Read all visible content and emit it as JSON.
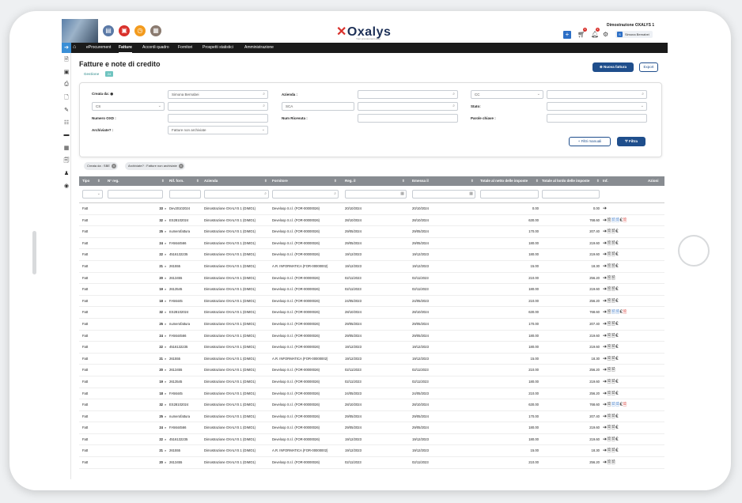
{
  "header": {
    "logo": "Oxalys",
    "logo_tagline": "Your procurement easy",
    "org_name": "Dimostrazione OXALYS 1",
    "user_initial": "S",
    "user_name": "Simona Bernabei",
    "cart_badge": "3",
    "bell_badge": "2",
    "icons": [
      "catalog-icon",
      "requests-icon",
      "timer-icon",
      "document-icon",
      "plus-icon",
      "cart-icon",
      "bell-icon",
      "settings-icon"
    ]
  },
  "nav": {
    "items": [
      "eProcurement",
      "Fatture",
      "Accordi quadro",
      "Fornitori",
      "Prospetti statistici",
      "Amministrazione"
    ],
    "active": "Fatture"
  },
  "page": {
    "title": "Fatture e note di credito",
    "subtitle": "Gestione",
    "subtitle_badge": "24",
    "new_button": "Nuova fattura",
    "export_button": "Export"
  },
  "filters": {
    "created_by_label": "Creata da:",
    "created_by_value": "Simona Bernabei",
    "cs_value": "CS",
    "azienda_label": "Azienda :",
    "sca_value": "SCA",
    "cc_value": "CC",
    "stato_label": "Stato:",
    "numero_oxd_label": "Numero OXD :",
    "num_ricevuta_label": "Num Ricevuta :",
    "parole_chiave_label": "Parole chiave :",
    "archiviate_label": "Archiviate? :",
    "archiviate_value": "Fatture non archiviate",
    "manual_filters_button": "Filtri manuali",
    "filter_button": "Filtra"
  },
  "chips": [
    "Creata da : SBE",
    "Archiviate? : Fatture non archiviate"
  ],
  "table": {
    "columns": [
      "Tipo",
      "N° reg.",
      "Rif. forn.",
      "Azienda",
      "Fornitore",
      "Reg. il",
      "Emessa il",
      "Totale al netto delle imposte",
      "Totale al lordo delle imposte",
      "Inf.",
      "Azioni"
    ],
    "rows": [
      {
        "tipo": "Fatt",
        "nreg": "33",
        "rif": "Dev20102024",
        "azienda": "Dimostrazione OXALYS 1 (DIMO1)",
        "fornitore": "Develoop S.r.l. (FOR-00000026)",
        "reg": "20/10/2024",
        "emessa": "20/10/2024",
        "netto": "0.00",
        "lordo": "0.00",
        "acts": "➔"
      },
      {
        "tipo": "Fatt",
        "nreg": "32",
        "rif": "ES28102024",
        "azienda": "Dimostrazione OXALYS 1 (DIMO1)",
        "fornitore": "Develoop S.r.l. (FOR-00000026)",
        "reg": "28/10/2024",
        "emessa": "28/10/2024",
        "netto": "630.00",
        "lordo": "768.60",
        "acts": "full"
      },
      {
        "tipo": "Fatt",
        "nreg": "25",
        "rif": "numerofattura",
        "azienda": "Dimostrazione OXALYS 1 (DIMO1)",
        "fornitore": "Develoop S.r.l. (FOR-00000026)",
        "reg": "29/05/2024",
        "emessa": "29/05/2024",
        "netto": "170.00",
        "lordo": "207.40",
        "acts": "std"
      },
      {
        "tipo": "Fatt",
        "nreg": "24",
        "rif": "FA5644566",
        "azienda": "Dimostrazione OXALYS 1 (DIMO1)",
        "fornitore": "Develoop S.r.l. (FOR-00000026)",
        "reg": "29/05/2024",
        "emessa": "29/05/2024",
        "netto": "180.00",
        "lordo": "219.60",
        "acts": "std"
      },
      {
        "tipo": "Fatt",
        "nreg": "22",
        "rif": "4516132235",
        "azienda": "Dimostrazione OXALYS 1 (DIMO1)",
        "fornitore": "Develoop S.r.l. (FOR-00000026)",
        "reg": "19/12/2023",
        "emessa": "19/12/2023",
        "netto": "180.00",
        "lordo": "219.60",
        "acts": "std"
      },
      {
        "tipo": "Fatt",
        "nreg": "21",
        "rif": "261555",
        "azienda": "Dimostrazione OXALYS 1 (DIMO1)",
        "fornitore": "A.R. INFORMATICA (FOR-00000002)",
        "reg": "19/12/2023",
        "emessa": "19/12/2023",
        "netto": "15.00",
        "lordo": "18.30",
        "acts": "std"
      },
      {
        "tipo": "Fatt",
        "nreg": "20",
        "rif": "2613455",
        "azienda": "Dimostrazione OXALYS 1 (DIMO1)",
        "fornitore": "Develoop S.r.l. (FOR-00000026)",
        "reg": "02/11/2023",
        "emessa": "02/11/2023",
        "netto": "210.00",
        "lordo": "256.20",
        "acts": "short"
      },
      {
        "tipo": "Fatt",
        "nreg": "19",
        "rif": "2613545",
        "azienda": "Dimostrazione OXALYS 1 (DIMO1)",
        "fornitore": "Develoop S.r.l. (FOR-00000026)",
        "reg": "02/11/2023",
        "emessa": "02/11/2023",
        "netto": "180.00",
        "lordo": "219.60",
        "acts": "std"
      },
      {
        "tipo": "Fatt",
        "nreg": "18",
        "rif": "FA56445",
        "azienda": "Dimostrazione OXALYS 1 (DIMO1)",
        "fornitore": "Develoop S.r.l. (FOR-00000026)",
        "reg": "24/05/2023",
        "emessa": "24/05/2023",
        "netto": "210.00",
        "lordo": "256.20",
        "acts": "std"
      },
      {
        "tipo": "Fatt",
        "nreg": "32",
        "rif": "ES28102024",
        "azienda": "Dimostrazione OXALYS 1 (DIMO1)",
        "fornitore": "Develoop S.r.l. (FOR-00000026)",
        "reg": "28/10/2024",
        "emessa": "28/10/2024",
        "netto": "630.00",
        "lordo": "768.60",
        "acts": "full"
      },
      {
        "tipo": "Fatt",
        "nreg": "25",
        "rif": "numerofattura",
        "azienda": "Dimostrazione OXALYS 1 (DIMO1)",
        "fornitore": "Develoop S.r.l. (FOR-00000026)",
        "reg": "29/05/2024",
        "emessa": "29/05/2024",
        "netto": "170.00",
        "lordo": "207.40",
        "acts": "std"
      },
      {
        "tipo": "Fatt",
        "nreg": "24",
        "rif": "FA5644566",
        "azienda": "Dimostrazione OXALYS 1 (DIMO1)",
        "fornitore": "Develoop S.r.l. (FOR-00000026)",
        "reg": "29/05/2024",
        "emessa": "29/05/2024",
        "netto": "180.00",
        "lordo": "219.60",
        "acts": "std"
      },
      {
        "tipo": "Fatt",
        "nreg": "22",
        "rif": "4516132235",
        "azienda": "Dimostrazione OXALYS 1 (DIMO1)",
        "fornitore": "Develoop S.r.l. (FOR-00000026)",
        "reg": "19/12/2023",
        "emessa": "19/12/2023",
        "netto": "180.00",
        "lordo": "219.60",
        "acts": "std"
      },
      {
        "tipo": "Fatt",
        "nreg": "21",
        "rif": "261555",
        "azienda": "Dimostrazione OXALYS 1 (DIMO1)",
        "fornitore": "A.R. INFORMATICA (FOR-00000002)",
        "reg": "19/12/2023",
        "emessa": "19/12/2023",
        "netto": "15.00",
        "lordo": "18.30",
        "acts": "std"
      },
      {
        "tipo": "Fatt",
        "nreg": "20",
        "rif": "2613455",
        "azienda": "Dimostrazione OXALYS 1 (DIMO1)",
        "fornitore": "Develoop S.r.l. (FOR-00000026)",
        "reg": "02/11/2023",
        "emessa": "02/11/2023",
        "netto": "210.00",
        "lordo": "256.20",
        "acts": "short"
      },
      {
        "tipo": "Fatt",
        "nreg": "19",
        "rif": "2613545",
        "azienda": "Dimostrazione OXALYS 1 (DIMO1)",
        "fornitore": "Develoop S.r.l. (FOR-00000026)",
        "reg": "02/11/2023",
        "emessa": "02/11/2023",
        "netto": "180.00",
        "lordo": "219.60",
        "acts": "std"
      },
      {
        "tipo": "Fatt",
        "nreg": "18",
        "rif": "FA56445",
        "azienda": "Dimostrazione OXALYS 1 (DIMO1)",
        "fornitore": "Develoop S.r.l. (FOR-00000026)",
        "reg": "24/05/2023",
        "emessa": "24/05/2023",
        "netto": "210.00",
        "lordo": "256.20",
        "acts": "std"
      },
      {
        "tipo": "Fatt",
        "nreg": "32",
        "rif": "ES28102024",
        "azienda": "Dimostrazione OXALYS 1 (DIMO1)",
        "fornitore": "Develoop S.r.l. (FOR-00000026)",
        "reg": "28/10/2024",
        "emessa": "28/10/2024",
        "netto": "630.00",
        "lordo": "768.60",
        "acts": "full"
      },
      {
        "tipo": "Fatt",
        "nreg": "25",
        "rif": "numerofattura",
        "azienda": "Dimostrazione OXALYS 1 (DIMO1)",
        "fornitore": "Develoop S.r.l. (FOR-00000026)",
        "reg": "29/05/2024",
        "emessa": "29/05/2024",
        "netto": "170.00",
        "lordo": "207.40",
        "acts": "std"
      },
      {
        "tipo": "Fatt",
        "nreg": "24",
        "rif": "FA5644566",
        "azienda": "Dimostrazione OXALYS 1 (DIMO1)",
        "fornitore": "Develoop S.r.l. (FOR-00000026)",
        "reg": "29/05/2024",
        "emessa": "29/05/2024",
        "netto": "180.00",
        "lordo": "219.60",
        "acts": "std"
      },
      {
        "tipo": "Fatt",
        "nreg": "22",
        "rif": "4516132235",
        "azienda": "Dimostrazione OXALYS 1 (DIMO1)",
        "fornitore": "Develoop S.r.l. (FOR-00000026)",
        "reg": "19/12/2023",
        "emessa": "19/12/2023",
        "netto": "180.00",
        "lordo": "219.60",
        "acts": "std"
      },
      {
        "tipo": "Fatt",
        "nreg": "21",
        "rif": "261555",
        "azienda": "Dimostrazione OXALYS 1 (DIMO1)",
        "fornitore": "A.R. INFORMATICA (FOR-00000002)",
        "reg": "19/12/2023",
        "emessa": "19/12/2023",
        "netto": "15.00",
        "lordo": "18.30",
        "acts": "std"
      },
      {
        "tipo": "Fatt",
        "nreg": "20",
        "rif": "2613455",
        "azienda": "Dimostrazione OXALYS 1 (DIMO1)",
        "fornitore": "Develoop S.r.l. (FOR-00000026)",
        "reg": "02/11/2023",
        "emessa": "02/11/2023",
        "netto": "210.00",
        "lordo": "256.20",
        "acts": "short"
      }
    ]
  },
  "colors": {
    "accent": "#1f4e8c",
    "nav_bg": "#1a1a1a",
    "header_row": "#888c91",
    "alert": "#d9302b",
    "link": "#2c6fc6"
  }
}
